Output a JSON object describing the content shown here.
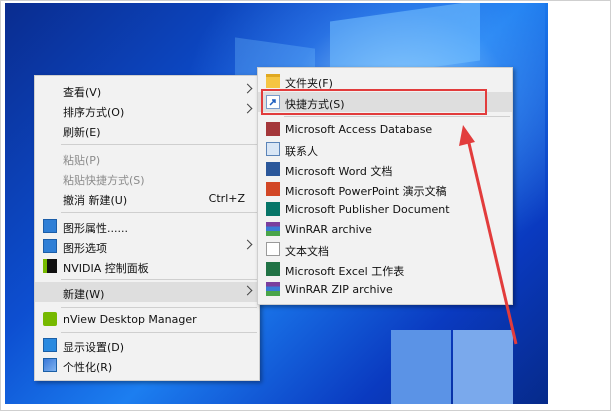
{
  "context_menu": {
    "items": [
      {
        "label": "查看(V)"
      },
      {
        "label": "排序方式(O)"
      },
      {
        "label": "刷新(E)"
      },
      {
        "label": "粘贴(P)"
      },
      {
        "label": "粘贴快捷方式(S)"
      },
      {
        "label": "撤消 新建(U)",
        "shortcut": "Ctrl+Z"
      },
      {
        "label": "图形属性......"
      },
      {
        "label": "图形选项"
      },
      {
        "label": "NVIDIA 控制面板"
      },
      {
        "label": "新建(W)"
      },
      {
        "label": "nView Desktop Manager"
      },
      {
        "label": "显示设置(D)"
      },
      {
        "label": "个性化(R)"
      }
    ]
  },
  "new_submenu": {
    "items": [
      {
        "label": "文件夹(F)",
        "icon": "folder-icon"
      },
      {
        "label": "快捷方式(S)",
        "icon": "shortcut-icon"
      },
      {
        "label": "Microsoft Access Database",
        "icon": "access-icon"
      },
      {
        "label": "联系人",
        "icon": "contact-icon"
      },
      {
        "label": "Microsoft Word 文档",
        "icon": "word-icon"
      },
      {
        "label": "Microsoft PowerPoint 演示文稿",
        "icon": "powerpoint-icon"
      },
      {
        "label": "Microsoft Publisher Document",
        "icon": "publisher-icon"
      },
      {
        "label": "WinRAR archive",
        "icon": "winrar-icon"
      },
      {
        "label": "文本文档",
        "icon": "text-document-icon"
      },
      {
        "label": "Microsoft Excel 工作表",
        "icon": "excel-icon"
      },
      {
        "label": "WinRAR ZIP archive",
        "icon": "winrar-zip-icon"
      }
    ]
  },
  "colors": {
    "annotation": "#e23c3c",
    "menu_bg": "#f2f2f2",
    "highlight": "#dedede"
  }
}
